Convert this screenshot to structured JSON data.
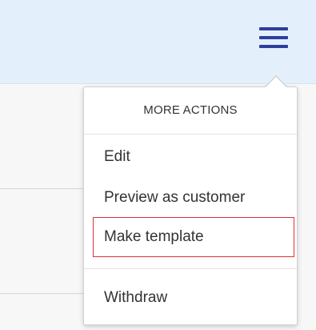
{
  "header": {
    "menu_icon": "hamburger-menu-icon",
    "accent_color": "#2d3e9c",
    "background_color": "#e3effb"
  },
  "dropdown": {
    "title": "MORE ACTIONS",
    "items": [
      {
        "label": "Edit"
      },
      {
        "label": "Preview as customer"
      },
      {
        "label": "Make template",
        "highlighted": true
      },
      {
        "label": "Withdraw"
      }
    ],
    "highlight_color": "#e0303a"
  }
}
